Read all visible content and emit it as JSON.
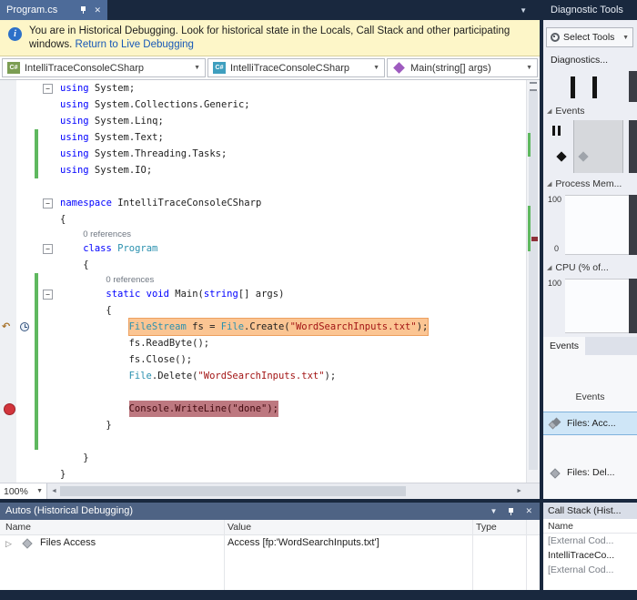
{
  "icons": {
    "pin-icon": "css-shape",
    "close-icon": "✕",
    "chevron-down-icon": "▼",
    "info-icon": "i",
    "fold-collapse-icon": "−",
    "historical-return-icon": "↶",
    "clock-icon": "css-shape",
    "breakpoint-icon": "css-circle",
    "expander-collapsed-icon": "▷",
    "section-triangle-icon": "◢",
    "gear-icon": "css-shape",
    "pause-icon": "css-shape",
    "event-diamond-icon": "css-diamond",
    "csharp-project-icon": "C#",
    "method-icon": "css-diamond",
    "scroll-left-icon": "◄",
    "scroll-right-icon": "►"
  },
  "doc_tab": {
    "title": "Program.cs"
  },
  "infobar": {
    "message": "You are in Historical Debugging. Look for historical state in the Locals, Call Stack and other participating windows.",
    "link": "Return to Live Debugging"
  },
  "navbar": {
    "project_dropdown": "IntelliTraceConsoleCSharp",
    "type_dropdown": "IntelliTraceConsoleCSharp",
    "member_dropdown": "Main(string[] args)"
  },
  "editor": {
    "zoom": "100%",
    "lines": [
      {
        "fold": "-",
        "segs": [
          [
            "k",
            "using"
          ],
          [
            "p",
            " System;"
          ]
        ]
      },
      {
        "segs": [
          [
            "k",
            "using"
          ],
          [
            "p",
            " System.Collections.Generic;"
          ]
        ]
      },
      {
        "segs": [
          [
            "k",
            "using"
          ],
          [
            "p",
            " System.Linq;"
          ]
        ]
      },
      {
        "chg": 1,
        "segs": [
          [
            "k",
            "using"
          ],
          [
            "p",
            " System.Text;"
          ]
        ]
      },
      {
        "chg": 1,
        "segs": [
          [
            "k",
            "using"
          ],
          [
            "p",
            " System.Threading.Tasks;"
          ]
        ]
      },
      {
        "chg": 1,
        "segs": [
          [
            "k",
            "using"
          ],
          [
            "p",
            " System.IO;"
          ]
        ]
      },
      {
        "segs": []
      },
      {
        "fold": "-",
        "segs": [
          [
            "k",
            "namespace"
          ],
          [
            "p",
            " IntelliTraceConsoleCSharp"
          ]
        ]
      },
      {
        "segs": [
          [
            "p",
            "{"
          ]
        ]
      },
      {
        "lens": "0 references",
        "ind": 4
      },
      {
        "fold": "-",
        "ind": 4,
        "segs": [
          [
            "k",
            "class"
          ],
          [
            "p",
            " "
          ],
          [
            "t",
            "Program"
          ]
        ]
      },
      {
        "ind": 4,
        "segs": [
          [
            "p",
            "{"
          ]
        ]
      },
      {
        "lens": "0 references",
        "ind": 8,
        "chg": 1
      },
      {
        "fold": "-",
        "ind": 8,
        "chg": 1,
        "segs": [
          [
            "k",
            "static"
          ],
          [
            "p",
            " "
          ],
          [
            "k",
            "void"
          ],
          [
            "p",
            " Main("
          ],
          [
            "k",
            "string"
          ],
          [
            "p",
            "[] args)"
          ]
        ]
      },
      {
        "ind": 8,
        "chg": 1,
        "segs": [
          [
            "p",
            "{"
          ]
        ]
      },
      {
        "ind": 12,
        "chg": 1,
        "hl": "orange",
        "icons": [
          "historical",
          "clock"
        ],
        "segs": [
          [
            "t",
            "FileStream"
          ],
          [
            "p",
            " fs = "
          ],
          [
            "t",
            "File"
          ],
          [
            "p",
            ".Create("
          ],
          [
            "s",
            "\"WordSearchInputs.txt\""
          ],
          [
            "p",
            ");"
          ]
        ]
      },
      {
        "ind": 12,
        "chg": 1,
        "segs": [
          [
            "p",
            "fs.ReadByte();"
          ]
        ]
      },
      {
        "ind": 12,
        "chg": 1,
        "segs": [
          [
            "p",
            "fs.Close();"
          ]
        ]
      },
      {
        "ind": 12,
        "chg": 1,
        "segs": [
          [
            "t",
            "File"
          ],
          [
            "p",
            ".Delete("
          ],
          [
            "s",
            "\"WordSearchInputs.txt\""
          ],
          [
            "p",
            ");"
          ]
        ]
      },
      {
        "ind": 12,
        "chg": 1,
        "segs": []
      },
      {
        "ind": 12,
        "chg": 1,
        "hl": "red",
        "bp": 1,
        "segs": [
          [
            "t",
            "Console"
          ],
          [
            "p",
            ".WriteLine("
          ],
          [
            "s",
            "\"done\""
          ],
          [
            "p",
            ");"
          ]
        ]
      },
      {
        "ind": 8,
        "chg": 1,
        "segs": [
          [
            "p",
            "}"
          ]
        ]
      },
      {
        "chg": 1,
        "segs": []
      },
      {
        "ind": 4,
        "segs": [
          [
            "p",
            "}"
          ]
        ]
      },
      {
        "segs": [
          [
            "p",
            "}"
          ]
        ]
      }
    ]
  },
  "diagnostics": {
    "panel_title": "Diagnostic Tools",
    "select_tools_button": "Select Tools",
    "diagnostics_label": "Diagnostics...",
    "events_section": "Events",
    "process_memory_section": "Process Mem...",
    "cpu_section": "CPU (% of...",
    "memory_axis_max": "100",
    "memory_axis_min": "0",
    "cpu_axis_max": "100",
    "events_tab": "Events",
    "events_list_header": "Events",
    "events_rows": [
      {
        "label": "Files: Acc...",
        "selected": true,
        "icon": "stack"
      },
      {
        "label": "Files: Del...",
        "selected": false,
        "icon": "diamond"
      }
    ]
  },
  "autos": {
    "panel_title": "Autos (Historical Debugging)",
    "columns": [
      "Name",
      "Value",
      "Type"
    ],
    "rows": [
      {
        "name": "Files Access",
        "value": "Access [fp:'WordSearchInputs.txt']",
        "type": ""
      }
    ]
  },
  "callstack": {
    "panel_title": "Call Stack (Hist...",
    "name_column": "Name",
    "rows": [
      {
        "label": "[External Cod...",
        "external": true
      },
      {
        "label": "IntelliTraceCo...",
        "external": false
      },
      {
        "label": "[External Cod...",
        "external": true
      }
    ]
  }
}
